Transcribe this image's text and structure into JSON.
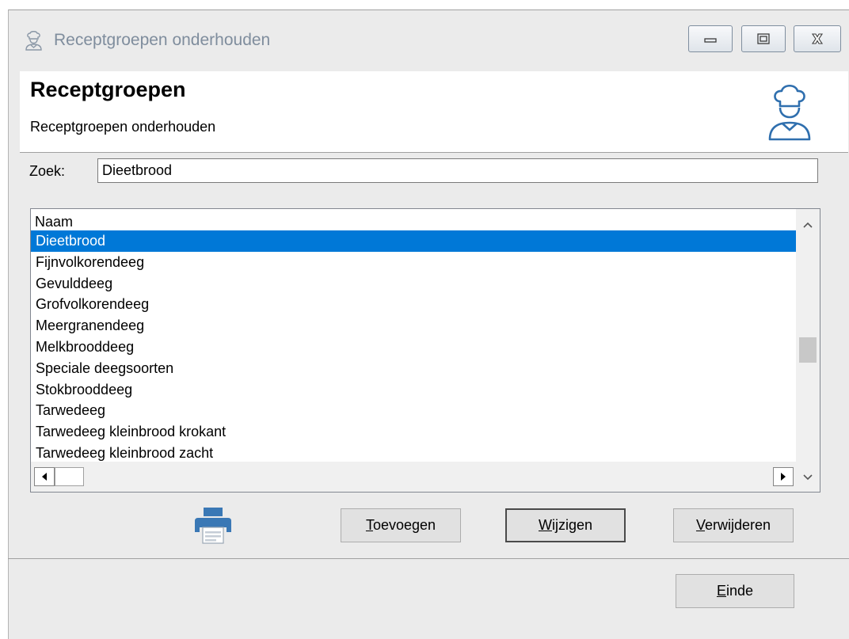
{
  "window": {
    "title": "Receptgroepen onderhouden",
    "title_icon": "chef-icon",
    "controls": {
      "minimize": "minimize-icon",
      "maximize": "maximize-icon",
      "close": "close-icon"
    }
  },
  "header": {
    "title": "Receptgroepen",
    "subtitle": "Receptgroepen onderhouden",
    "icon": "chef-icon"
  },
  "search": {
    "label": "Zoek:",
    "value": "Dieetbrood"
  },
  "list": {
    "column_header": "Naam",
    "selected_index": 0,
    "items": [
      "Dieetbrood",
      "Fijnvolkorendeeg",
      "Gevulddeeg",
      "Grofvolkorendeeg",
      "Meergranendeeg",
      "Melkbrooddeeg",
      "Speciale deegsoorten",
      "Stokbrooddeeg",
      "Tarwedeeg",
      "Tarwedeeg kleinbrood krokant",
      "Tarwedeeg kleinbrood zacht"
    ]
  },
  "actions": {
    "print_icon": "printer-icon",
    "add_label": "Toevoegen",
    "edit_label": "Wijzigen",
    "delete_label": "Verwijderen"
  },
  "footer": {
    "close_label": "Einde"
  },
  "colors": {
    "selection": "#0078d7",
    "title_text": "#7f8d9d",
    "window_bg": "#ebebeb",
    "button_bg": "#e1e1e1",
    "printer_blue": "#3a78b5"
  }
}
